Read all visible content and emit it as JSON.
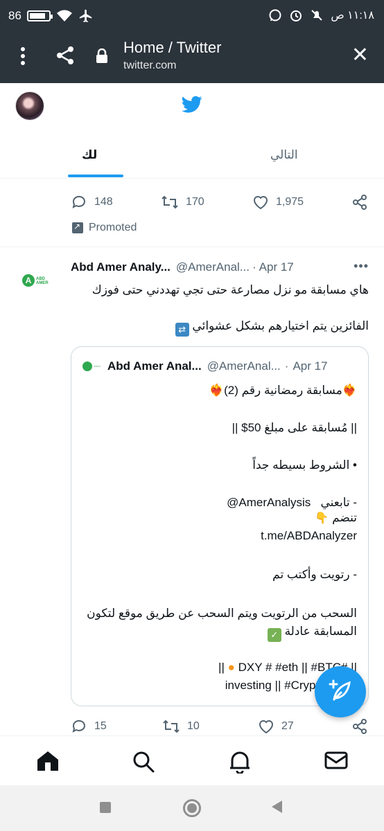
{
  "status_bar": {
    "battery": "86",
    "battery_level_percent": 86,
    "time": "١١:١٨ ص"
  },
  "browser_tab": {
    "title": "Home / Twitter",
    "url": "twitter.com"
  },
  "twitter_header": {
    "tabs": [
      {
        "label": "لك",
        "active": true
      },
      {
        "label": "التالي",
        "active": false
      }
    ]
  },
  "promoted_tweet": {
    "replies": "148",
    "retweets": "170",
    "likes": "1,975",
    "promoted_label": "Promoted"
  },
  "tweet": {
    "name": "Abd Amer Analy...",
    "handle": "@AmerAnal...",
    "separator": "·",
    "date": "Apr 17",
    "more": "•••",
    "text_line1": "هاي مسابقة مو نزل مصارعة حتى تجي تهددني حتى فوزك",
    "text_line2": "الفائزين يتم اختيارهم بشكل عشوائي",
    "avatar_text": "ABD AMER",
    "quote": {
      "name": "Abd Amer Anal...",
      "handle": "@AmerAnal...",
      "date": "Apr 17",
      "lines": [
        "مسابقة رمضانية رقم (2)",
        "|| مُسابقة على مبلغ 50$ ||",
        "• الشروط بسيطه جداً",
        "- تابعني",
        "@AmerAnalysis",
        "تنضم",
        "t.me/ABDAnalyzer",
        "- رتويت وأكتب تم",
        "السحب من الرتويت ويتم السحب عن طريق موقع لتكون",
        "المسابقة عادلة",
        "|| #DXY # #eth ||  #BTC",
        "#investing || #CryptoCom"
      ]
    },
    "replies": "15",
    "retweets": "10",
    "likes": "27"
  },
  "colors": {
    "accent": "#1d9bf0",
    "header_bg": "#2b333b",
    "secondary_text": "#536471",
    "logo_green": "#2fa84f"
  },
  "icons": [
    "twitter-bird-icon",
    "reply-icon",
    "retweet-icon",
    "like-icon",
    "share-icon",
    "home-icon",
    "search-icon",
    "notifications-icon",
    "messages-icon",
    "compose-icon"
  ]
}
